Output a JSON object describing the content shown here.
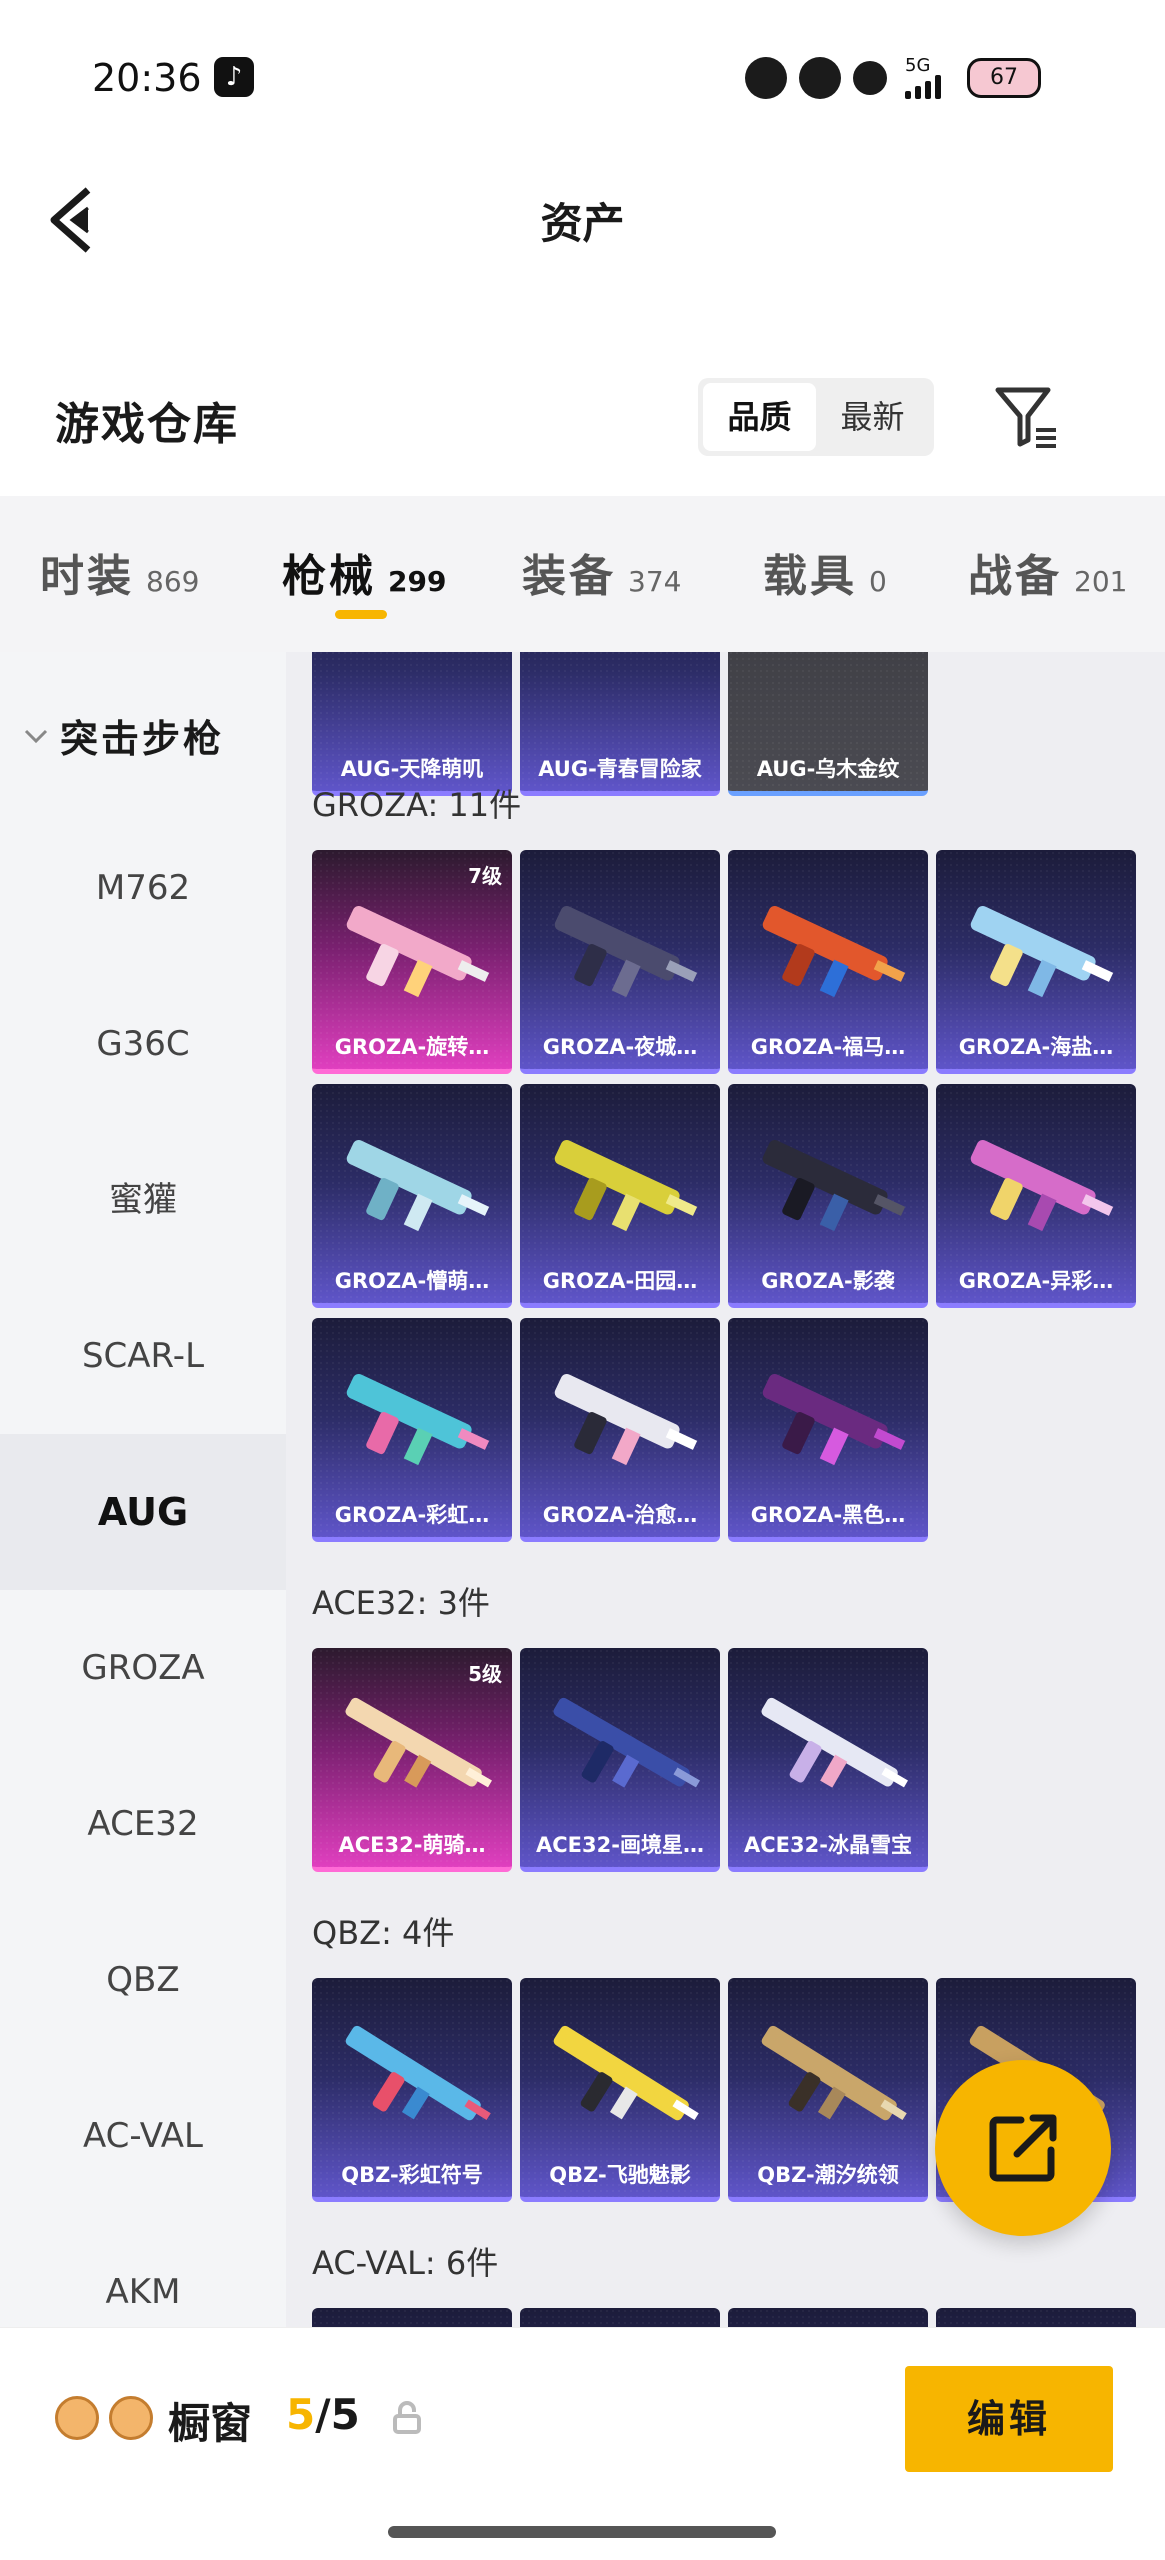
{
  "status_bar": {
    "time": "20:36",
    "network": "5G",
    "battery": "67",
    "icons": [
      "tiktok-icon",
      "flower-app-icon",
      "bear-app-icon",
      "paw-app-icon",
      "signal-icon",
      "battery-icon"
    ]
  },
  "header": {
    "title": "资产",
    "back_icon": "chevron-left-icon"
  },
  "warehouse": {
    "title": "游戏仓库",
    "sort_options": [
      "品质",
      "最新"
    ],
    "sort_active": "品质",
    "filter_icon": "filter-icon"
  },
  "categories": [
    {
      "name": "时装",
      "count": "869",
      "active": false
    },
    {
      "name": "枪械",
      "count": "299",
      "active": true
    },
    {
      "name": "装备",
      "count": "374",
      "active": false
    },
    {
      "name": "载具",
      "count": "0",
      "active": false
    },
    {
      "name": "战备",
      "count": "201",
      "active": false
    }
  ],
  "sidebar": {
    "group": "突击步枪",
    "items": [
      "M762",
      "G36C",
      "蜜獾",
      "SCAR-L",
      "AUG",
      "GROZA",
      "ACE32",
      "QBZ",
      "AC-VAL",
      "AKM"
    ],
    "active": "AUG"
  },
  "sections": {
    "aug_partial": [
      "AUG-天降萌叽",
      "AUG-青春冒险家",
      "AUG-乌木金纹"
    ],
    "groza": {
      "title": "GROZA: 11件",
      "level_badge": "7级",
      "cards": [
        "GROZA-旋转…",
        "GROZA-夜城…",
        "GROZA-福马…",
        "GROZA-海盐…",
        "GROZA-懵萌…",
        "GROZA-田园…",
        "GROZA-影袭",
        "GROZA-异彩…",
        "GROZA-彩虹…",
        "GROZA-治愈…",
        "GROZA-黑色…"
      ]
    },
    "ace32": {
      "title": "ACE32: 3件",
      "level_badge": "5级",
      "cards": [
        "ACE32-萌骑…",
        "ACE32-画境星…",
        "ACE32-冰晶雪宝"
      ]
    },
    "qbz": {
      "title": "QBZ: 4件",
      "cards": [
        "QBZ-彩虹符号",
        "QBZ-飞驰魅影",
        "QBZ-潮汐统领"
      ]
    },
    "acval": {
      "title": "AC-VAL: 6件"
    }
  },
  "showcase": {
    "label": "橱窗",
    "current": "5",
    "total": "/5",
    "edit_label": "编辑",
    "share_icon": "share-icon",
    "lock_icon": "lock-icon"
  }
}
